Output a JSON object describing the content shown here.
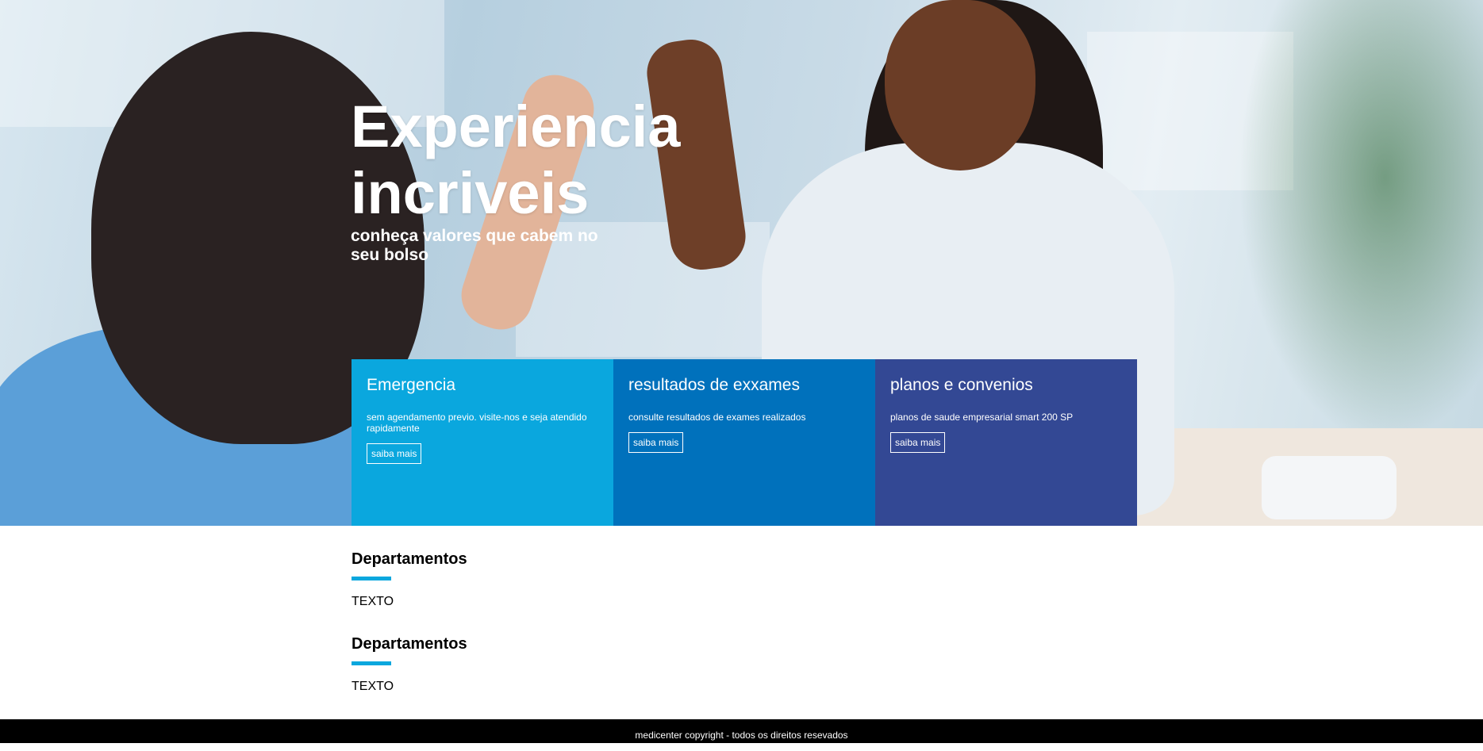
{
  "hero": {
    "title": "Experiencia incriveis",
    "subtitle": "conheça valores que cabem no seu bolso"
  },
  "cards": [
    {
      "title": "Emergencia",
      "text": "sem agendamento previo. visite-nos e seja atendido rapidamente",
      "button": "saiba mais",
      "color": "#0aa7de"
    },
    {
      "title": "resultados de exxames",
      "text": "consulte resultados de exames realizados",
      "button": "saiba mais",
      "color": "#0071bc"
    },
    {
      "title": "planos e convenios",
      "text": "planos de saude empresarial smart 200 SP",
      "button": "saiba mais",
      "color": "#334894"
    }
  ],
  "sections": [
    {
      "title": "Departamentos",
      "text": "TEXTO"
    },
    {
      "title": "Departamentos",
      "text": "TEXTO"
    }
  ],
  "footer": {
    "text": "medicenter copyright - todos os direitos resevados"
  },
  "colors": {
    "accent": "#0aa7de",
    "footer_bg": "#000000"
  }
}
